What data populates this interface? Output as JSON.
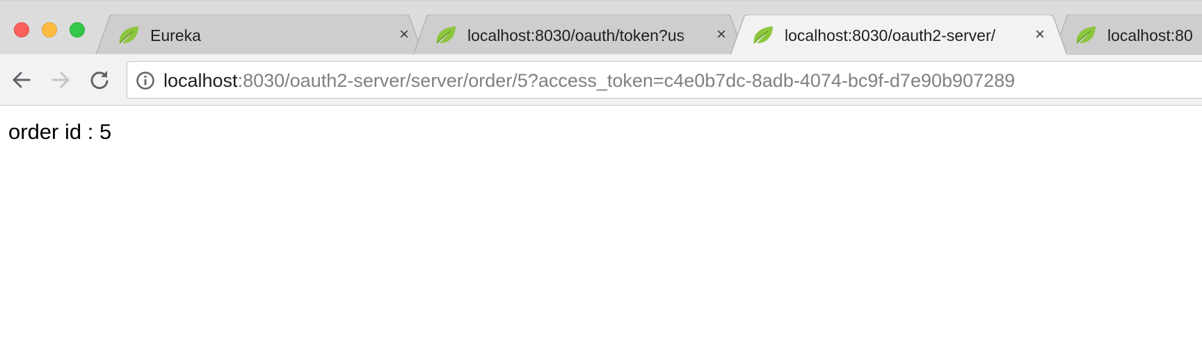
{
  "browser": {
    "tabs": [
      {
        "title": "Eureka",
        "active": false
      },
      {
        "title": "localhost:8030/oauth/token?us",
        "active": false
      },
      {
        "title": "localhost:8030/oauth2-server/",
        "active": true
      },
      {
        "title": "localhost:80",
        "active": false
      }
    ],
    "close_glyph": "×",
    "address_bar": {
      "host": "localhost",
      "path": ":8030/oauth2-server/server/order/5?access_token=c4e0b7dc-8adb-4074-bc9f-d7e90b907289"
    },
    "icons": {
      "favicon": "spring-leaf-icon",
      "back": "back-arrow-icon",
      "forward": "forward-arrow-icon",
      "reload": "reload-icon",
      "info": "info-icon"
    },
    "colors": {
      "favicon_green": "#8cc63f",
      "traffic_close": "#fc605c",
      "traffic_minimize": "#fdbc40",
      "traffic_maximize": "#34c84a"
    }
  },
  "page": {
    "text": "order id : 5"
  }
}
